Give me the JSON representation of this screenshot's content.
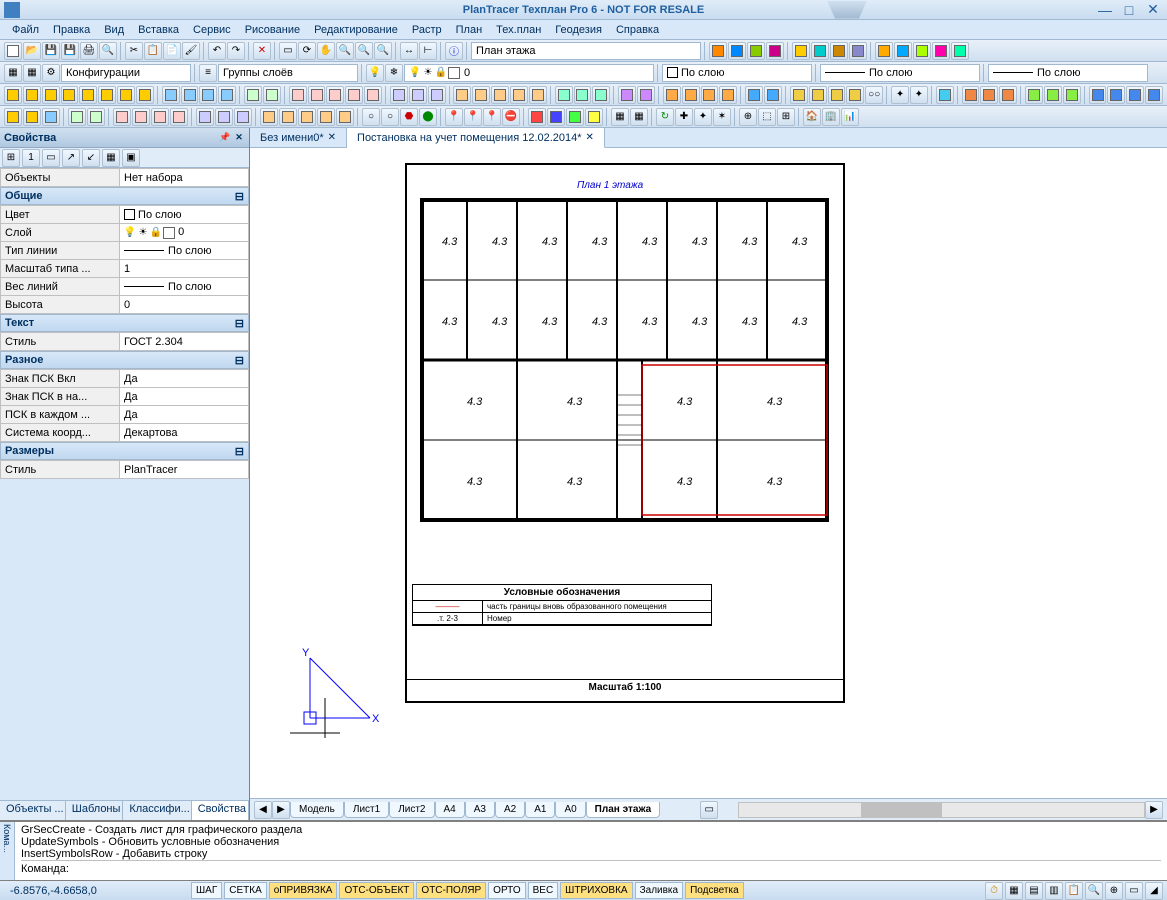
{
  "titlebar": {
    "title": "PlanTracer Техплан Pro 6 - NOT FOR RESALE"
  },
  "menu": [
    "Файл",
    "Правка",
    "Вид",
    "Вставка",
    "Сервис",
    "Рисование",
    "Редактирование",
    "Растр",
    "План",
    "Тех.план",
    "Геодезия",
    "Справка"
  ],
  "toolbar2": {
    "config_label": "Конфигурации",
    "groups_label": "Группы слоёв",
    "layer_value": "0",
    "bylayer1": "По слою",
    "bylayer2": "По слою",
    "bylayer3": "По слою"
  },
  "toolbar1_field": "План этажа",
  "properties": {
    "panel_title": "Свойства",
    "objects_label": "Объекты",
    "objects_value": "Нет набора",
    "sections": {
      "general": {
        "title": "Общие",
        "rows": [
          {
            "k": "Цвет",
            "v": "По слою"
          },
          {
            "k": "Слой",
            "v": "0"
          },
          {
            "k": "Тип линии",
            "v": "По слою"
          },
          {
            "k": "Масштаб типа ...",
            "v": "1"
          },
          {
            "k": "Вес линий",
            "v": "По слою"
          },
          {
            "k": "Высота",
            "v": "0"
          }
        ]
      },
      "text": {
        "title": "Текст",
        "rows": [
          {
            "k": "Стиль",
            "v": "ГОСТ 2.304"
          }
        ]
      },
      "misc": {
        "title": "Разное",
        "rows": [
          {
            "k": "Знак ПСК Вкл",
            "v": "Да"
          },
          {
            "k": "Знак ПСК в на...",
            "v": "Да"
          },
          {
            "k": "ПСК в каждом ...",
            "v": "Да"
          },
          {
            "k": "Система коорд...",
            "v": "Декартова"
          }
        ]
      },
      "dims": {
        "title": "Размеры",
        "rows": [
          {
            "k": "Стиль",
            "v": "PlanTracer"
          }
        ]
      }
    },
    "tabs": [
      "Объекты ...",
      "Шаблоны",
      "Классифи...",
      "Свойства"
    ]
  },
  "doc_tabs": [
    {
      "label": "Без имени0*",
      "active": false
    },
    {
      "label": "Постановка на учет помещения 12.02.2014*",
      "active": true
    }
  ],
  "drawing": {
    "plan_title": "План 1 этажа",
    "legend_title": "Условные обозначения",
    "legend_rows": [
      {
        "sym": "———",
        "txt": "часть границы вновь образованного помещения"
      },
      {
        "sym": ".т. 2-3",
        "txt": "Номер"
      }
    ],
    "scale": "Масштаб 1:100"
  },
  "bottom_tabs": [
    "Модель",
    "Лист1",
    "Лист2",
    "A4",
    "A3",
    "A2",
    "A1",
    "A0",
    "План этажа"
  ],
  "command": {
    "label": "Кома...",
    "lines": [
      "GrSecCreate - Создать лист для графического раздела",
      "UpdateSymbols - Обновить условные обозначения",
      "InsertSymbolsRow - Добавить строку"
    ],
    "prompt": "Команда:"
  },
  "status": {
    "coords": "-6.8576,-4.6658,0",
    "buttons": [
      {
        "label": "ШАГ",
        "active": false
      },
      {
        "label": "СЕТКА",
        "active": false
      },
      {
        "label": "оПРИВЯЗКА",
        "active": true
      },
      {
        "label": "ОТС-ОБЪЕКТ",
        "active": true
      },
      {
        "label": "ОТС-ПОЛЯР",
        "active": true
      },
      {
        "label": "ОРТО",
        "active": false
      },
      {
        "label": "ВЕС",
        "active": false
      },
      {
        "label": "ШТРИХОВКА",
        "active": true
      },
      {
        "label": "Заливка",
        "active": false
      },
      {
        "label": "Подсветка",
        "active": true
      }
    ]
  }
}
